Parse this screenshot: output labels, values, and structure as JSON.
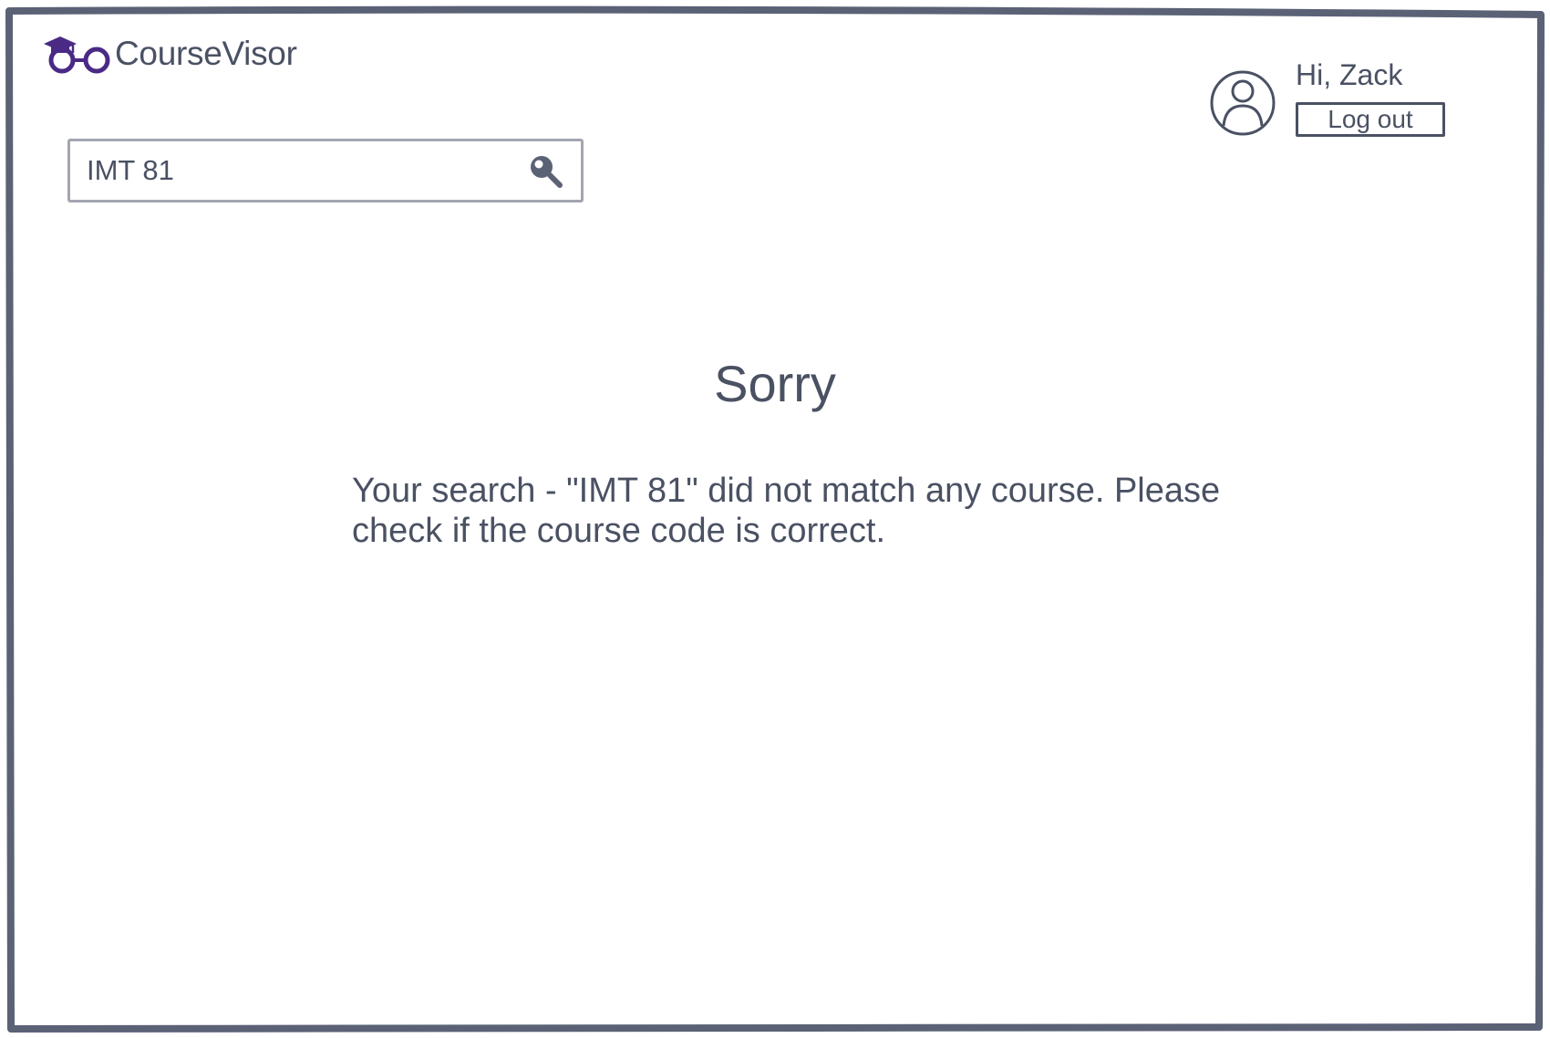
{
  "brand": {
    "name": "CourseVisor",
    "accent_color": "#4b2a85",
    "logo_icon": "graduation-cap-glasses-icon"
  },
  "search": {
    "value": "IMT 81",
    "icon": "search-icon"
  },
  "user": {
    "greeting": "Hi, Zack",
    "logout_label": "Log out",
    "avatar_icon": "user-avatar-icon"
  },
  "message": {
    "title": "Sorry",
    "body": "Your search - \"IMT 81\" did not match any course. Please check if the course code is correct."
  },
  "colors": {
    "text": "#4a5163",
    "border": "#5b6276",
    "input_border": "#a3a6b1"
  }
}
